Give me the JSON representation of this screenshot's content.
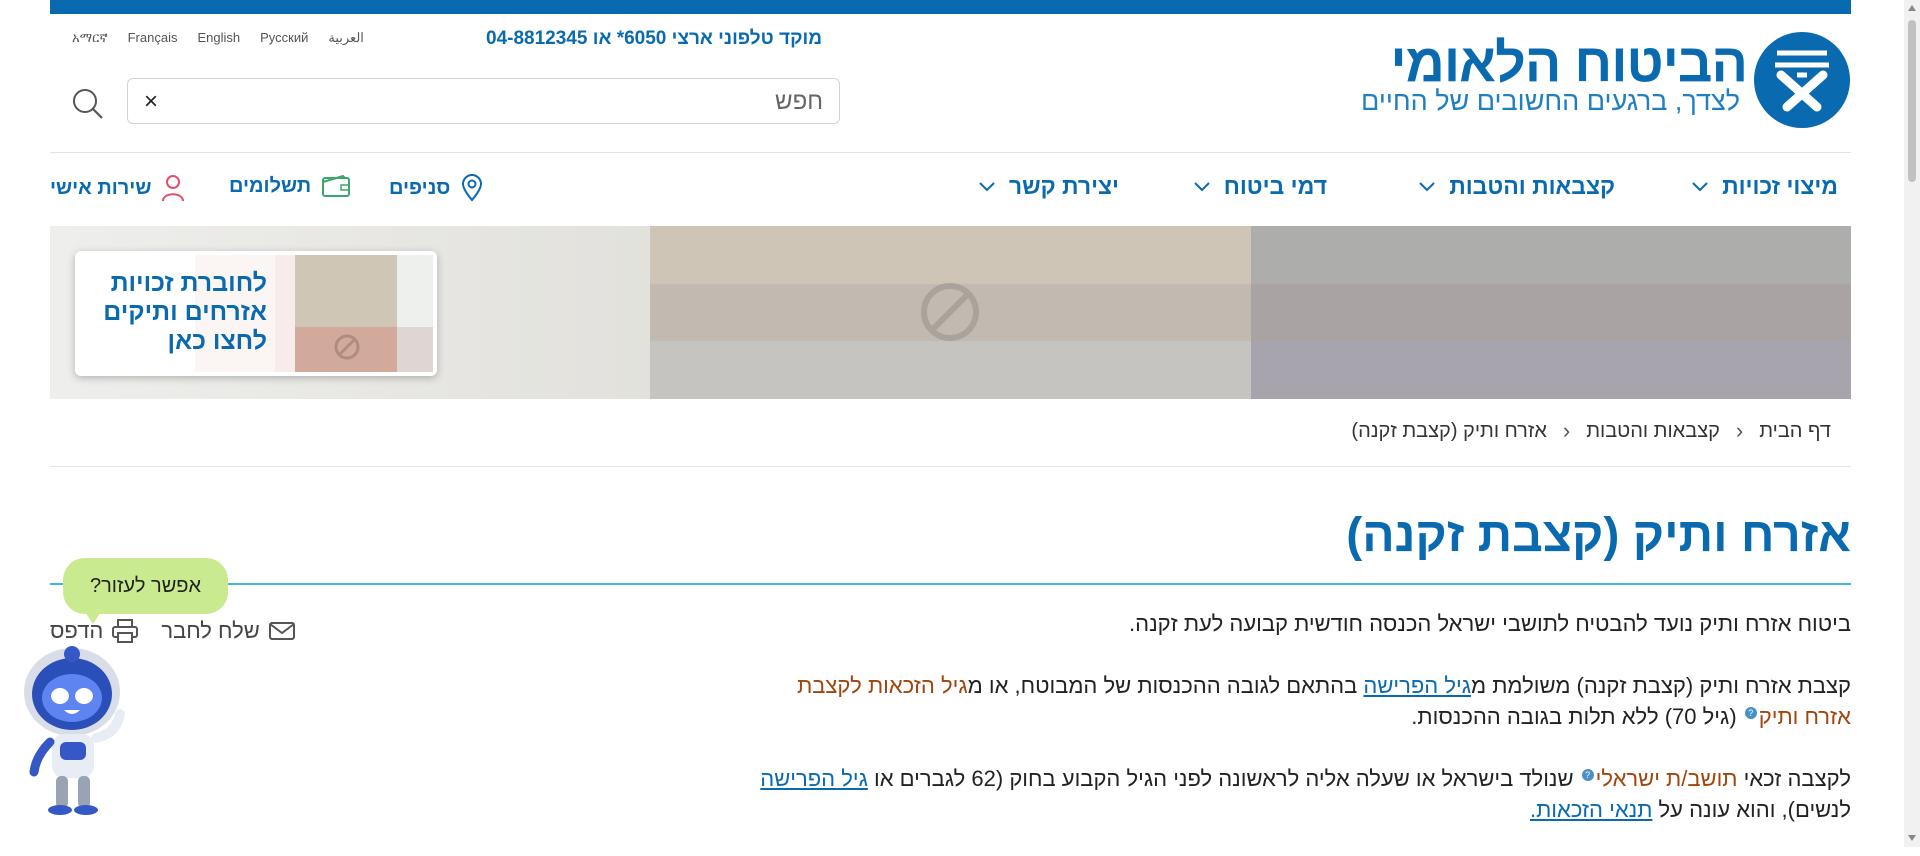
{
  "header": {
    "logo_title": "הביטוח הלאומי",
    "logo_subtitle": "לצדך, ברגעים החשובים של החיים",
    "hotline": "מוקד טלפוני ארצי 6050* או 04-8812345",
    "languages": [
      "العربية",
      "Русский",
      "English",
      "Français",
      "አማርኛ"
    ],
    "search_placeholder": "חפש",
    "search_clear": "×"
  },
  "nav": {
    "items": [
      {
        "label": "מיצוי זכויות"
      },
      {
        "label": "קצבאות והטבות"
      },
      {
        "label": "דמי ביטוח"
      },
      {
        "label": "יצירת קשר"
      }
    ],
    "utilities": [
      {
        "label": "סניפים",
        "icon": "location-pin-icon"
      },
      {
        "label": "תשלומים",
        "icon": "wallet-icon"
      },
      {
        "label": "שירות אישי",
        "icon": "person-icon"
      }
    ]
  },
  "banner": {
    "cta_lines": [
      "לחוברת זכויות",
      "אזרחים ותיקים",
      "לחצו כאן"
    ]
  },
  "breadcrumb": [
    "דף הבית",
    "קצבאות והטבות",
    "אזרח ותיק (קצבת זקנה)"
  ],
  "page": {
    "title": "אזרח ותיק (קצבת זקנה)",
    "print_label": "הדפס",
    "send_label": "שלח לחבר"
  },
  "content": {
    "p1": "ביטוח אזרח ותיק נועד להבטיח לתושבי ישראל הכנסה חודשית קבועה לעת זקנה.",
    "p2_a": "קצבת אזרח ותיק (קצבת זקנה) משולמת מ",
    "p2_link1": "גיל הפרישה",
    "p2_b": " בהתאם לגובה ההכנסות של המבוטח, או מ",
    "p2_term": "גיל הזכאות לקצבת אזרח ותיק",
    "p2_c": " (גיל 70) ללא תלות בגובה ההכנסות.",
    "p3_a": "לקצבה זכאי ",
    "p3_term": "תושב/ת ישראלי",
    "p3_b": " שנולד בישראל או שעלה אליה לראשונה לפני הגיל הקבוע בחוק (62 לגברים או ",
    "p3_link1": "גיל הפרישה",
    "p3_c": " לנשים), והוא עונה על ",
    "p3_link2": "תנאי הזכאות."
  },
  "chatbot": {
    "bubble": "אפשר לעזור?"
  },
  "colors": {
    "brand_blue": "#0a6ab0",
    "accent_cyan": "#3fb7e0",
    "term_orange": "#a0460c",
    "bubble_green": "#c9ea8e"
  }
}
